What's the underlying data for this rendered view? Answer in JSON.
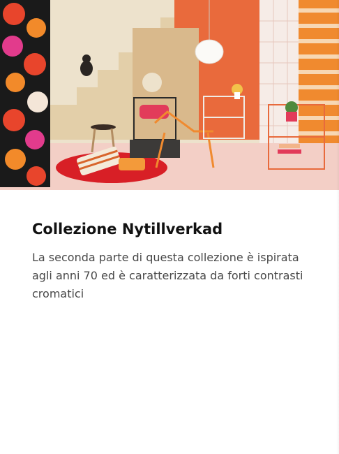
{
  "card": {
    "title": "Collezione Nytillverkad",
    "description": "La seconda parte di questa collezione è ispirata agli anni 70 ed è caratterizzata da forti contrasti cromatici"
  },
  "colors": {
    "title_text": "#111111",
    "body_text": "#484848",
    "background": "#ffffff",
    "accent_orange": "#e8662f",
    "accent_red": "#d81f26"
  }
}
